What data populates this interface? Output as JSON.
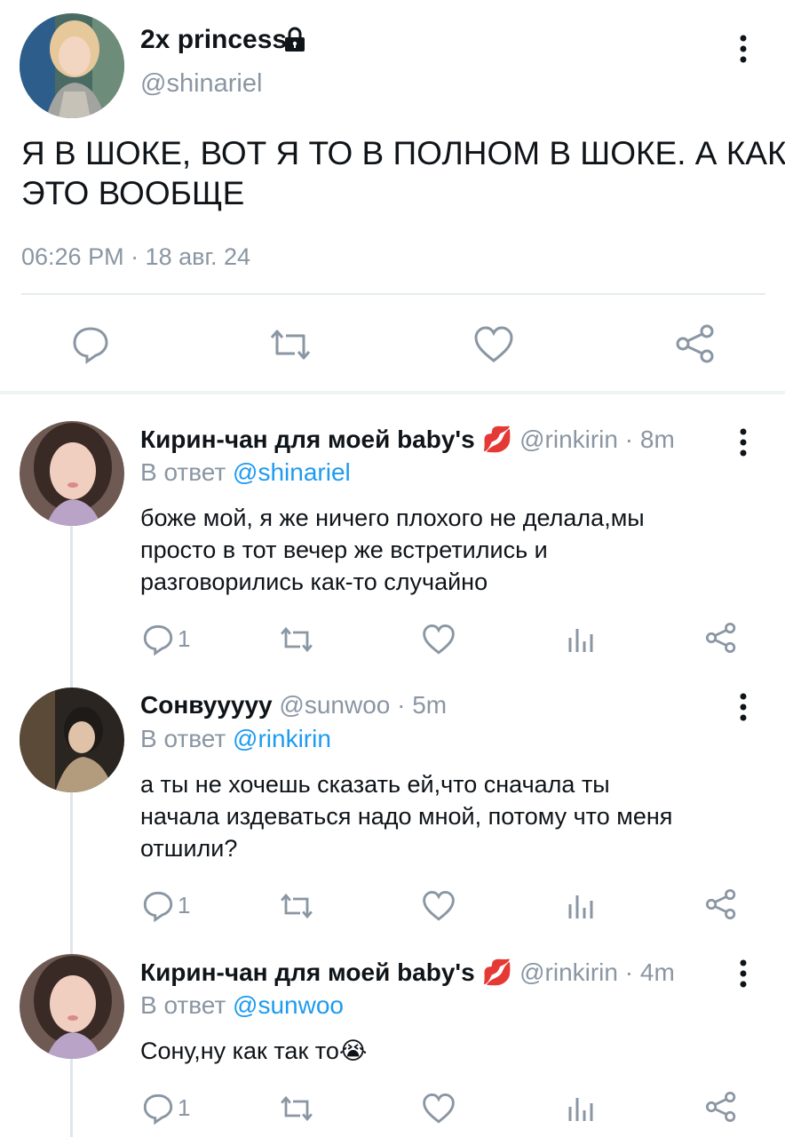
{
  "main_tweet": {
    "display_name": "2x princess",
    "handle": "@shinariel",
    "text_line1": "Я В ШОКЕ, ВОТ Я ТО В ПОЛНОМ В ШОКЕ. А КАК",
    "text_line2": "ЭТО ВООБЩЕ",
    "timestamp": "06:26 PM · 18 авг. 24",
    "icons": {
      "lock": "lock-icon",
      "more": "more-vertical-icon",
      "reply": "reply-icon",
      "retweet": "retweet-icon",
      "like": "heart-icon",
      "share": "share-icon"
    }
  },
  "replies": [
    {
      "display_name": "Кирин-чан для моей baby's",
      "name_emoji": "💋",
      "handle": "@rinkirin",
      "time": "· 8m",
      "reply_prefix": "В ответ",
      "reply_to": "@shinariel",
      "text_line1": "боже мой, я же ничего плохого не делала,мы",
      "text_line2": "просто в тот вечер же встретились и",
      "text_line3": "разговорились как-то случайно",
      "reply_count": "1"
    },
    {
      "display_name": "Сонвууууу",
      "handle": "@sunwoo",
      "time": "· 5m",
      "reply_prefix": "В ответ",
      "reply_to": "@rinkirin",
      "text_line1": "а ты не хочешь сказать ей,что сначала ты",
      "text_line2": "начала издеваться надо мной, потому что меня",
      "text_line3": "отшили?",
      "reply_count": "1"
    },
    {
      "display_name": "Кирин-чан для моей baby's",
      "name_emoji": "💋",
      "handle": "@rinkirin",
      "time": "· 4m",
      "reply_prefix": "В ответ",
      "reply_to": "@sunwoo",
      "text_line1": "Сону,ну как так то",
      "text_emoji": "😭",
      "reply_count": "1"
    }
  ],
  "colors": {
    "accent": "#1d9bf0",
    "secondary_text": "#8a96a3",
    "primary_text": "#0f1419",
    "icon": "#8a96a3"
  }
}
